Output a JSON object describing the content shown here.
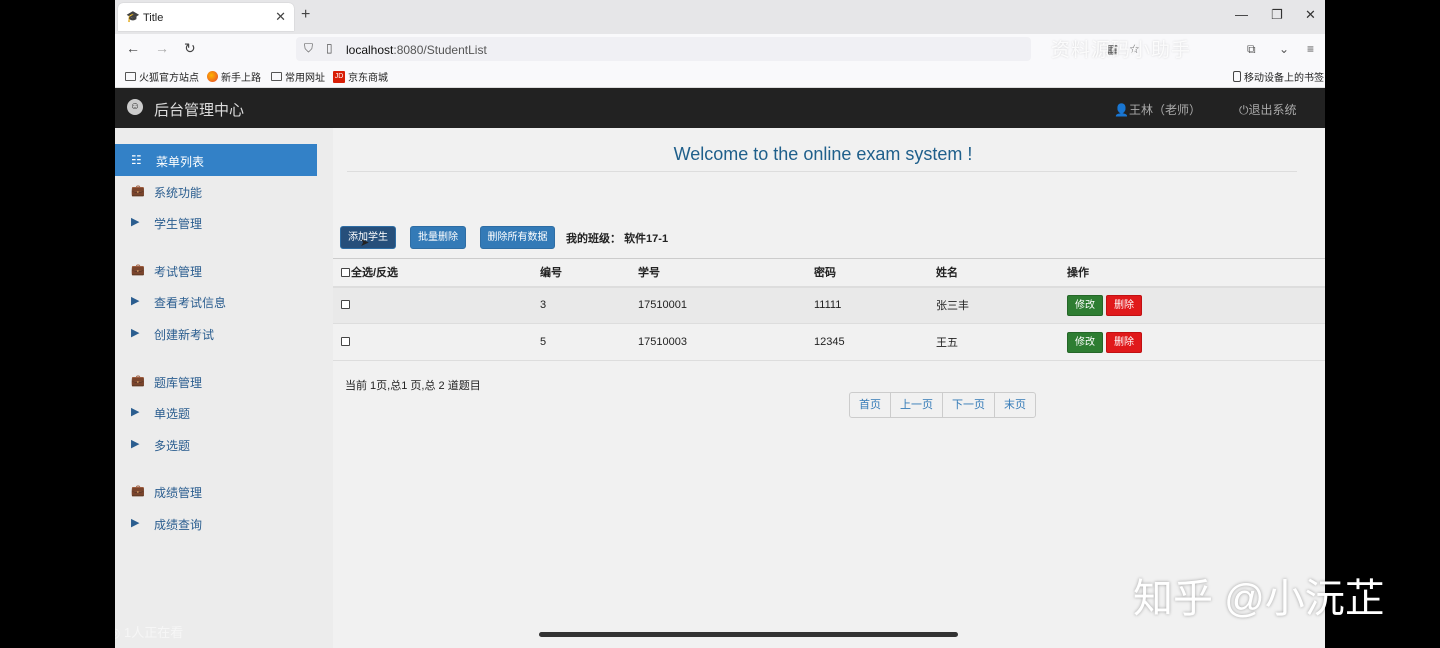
{
  "browser": {
    "tab_title": "Title",
    "url_host": "localhost",
    "url_rest": ":8080/StudentList",
    "bookmarks": [
      "火狐官方站点",
      "新手上路",
      "常用网址",
      "京东商城"
    ],
    "mobile_bookmarks": "移动设备上的书签",
    "watermark_top": "资料源码小助手"
  },
  "header": {
    "title": "后台管理中心",
    "user": "王林（老师）",
    "logout": "退出系统"
  },
  "sidebar": {
    "menu_title": "菜单列表",
    "items": [
      "系统功能",
      "学生管理",
      "考试管理",
      "查看考试信息",
      "创建新考试",
      "题库管理",
      "单选题",
      "多选题",
      "成绩管理",
      "成绩查询"
    ]
  },
  "overlay": {
    "live_viewers": "1人正在看",
    "watermark": "知乎 @小沅芷"
  },
  "main": {
    "welcome": "Welcome to the online exam system !",
    "buttons": {
      "add": "添加学生",
      "batch_delete": "批量删除",
      "delete_all": "删除所有数据"
    },
    "class_label": "我的班级：",
    "class_value": "软件17-1",
    "table": {
      "headers": [
        "全选/反选",
        "编号",
        "学号",
        "密码",
        "姓名",
        "操作"
      ],
      "rows": [
        {
          "id": "3",
          "student_no": "17510001",
          "password": "11111",
          "name": "张三丰"
        },
        {
          "id": "5",
          "student_no": "17510003",
          "password": "12345",
          "name": "王五"
        }
      ],
      "edit_label": "修改",
      "delete_label": "删除"
    },
    "page_info": "当前 1页,总1 页,总 2 道题目",
    "pager": [
      "首页",
      "上一页",
      "下一页",
      "末页"
    ]
  }
}
